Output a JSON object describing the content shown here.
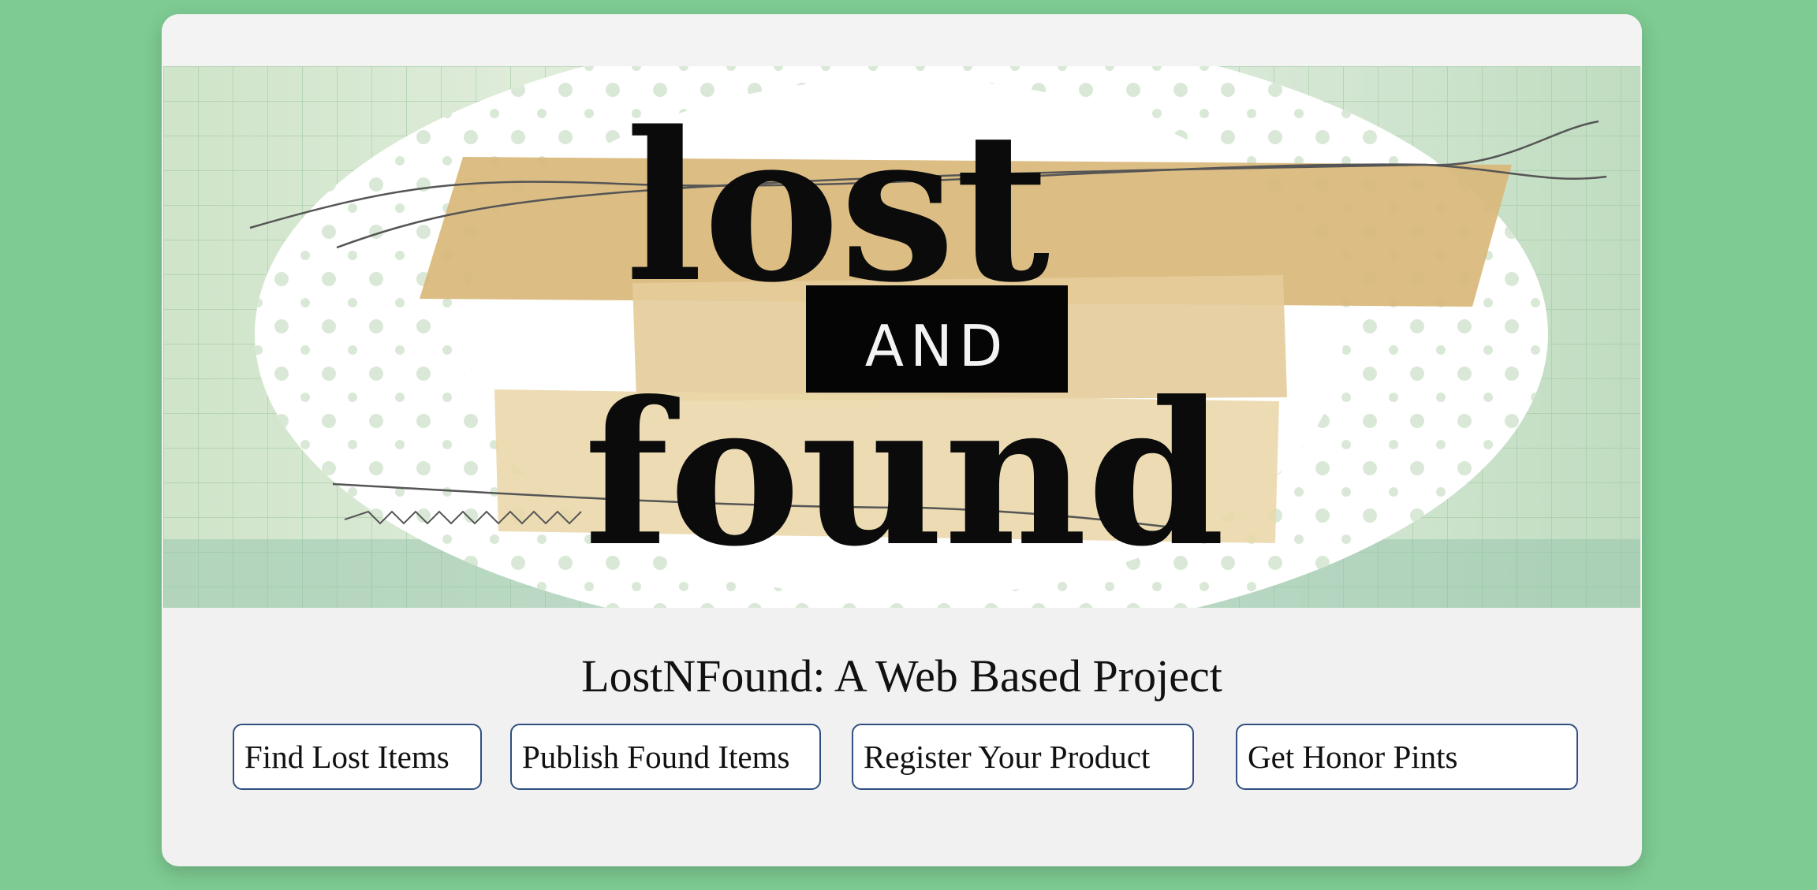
{
  "banner": {
    "word_top": "lost",
    "word_middle": "AND",
    "word_bottom": "found"
  },
  "page": {
    "title": "LostNFound: A Web Based Project"
  },
  "nav": {
    "buttons": [
      {
        "label": "Find Lost Items"
      },
      {
        "label": "Publish Found Items"
      },
      {
        "label": "Register Your Product"
      },
      {
        "label": "Get Honor Pints"
      }
    ]
  },
  "colors": {
    "background": "#7ecb93",
    "card": "#f1f1f1",
    "button_border": "#2f4f7f",
    "tape": "#d9b77a"
  }
}
